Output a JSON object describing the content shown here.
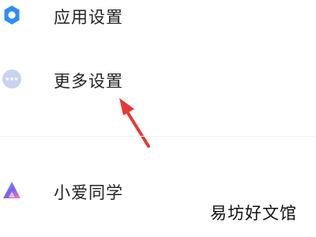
{
  "settings": {
    "items": [
      {
        "label": "应用设置",
        "icon": "gear-icon",
        "color": "#2f8df5"
      },
      {
        "label": "更多设置",
        "icon": "more-dots-icon",
        "color": "#c9d3f0"
      },
      {
        "label": "小爱同学",
        "icon": "xiaoai-icon",
        "color": "#7b5cf0"
      }
    ]
  },
  "annotation": {
    "arrow_color": "#e53935"
  },
  "watermark": {
    "text": "易坊好文馆"
  }
}
